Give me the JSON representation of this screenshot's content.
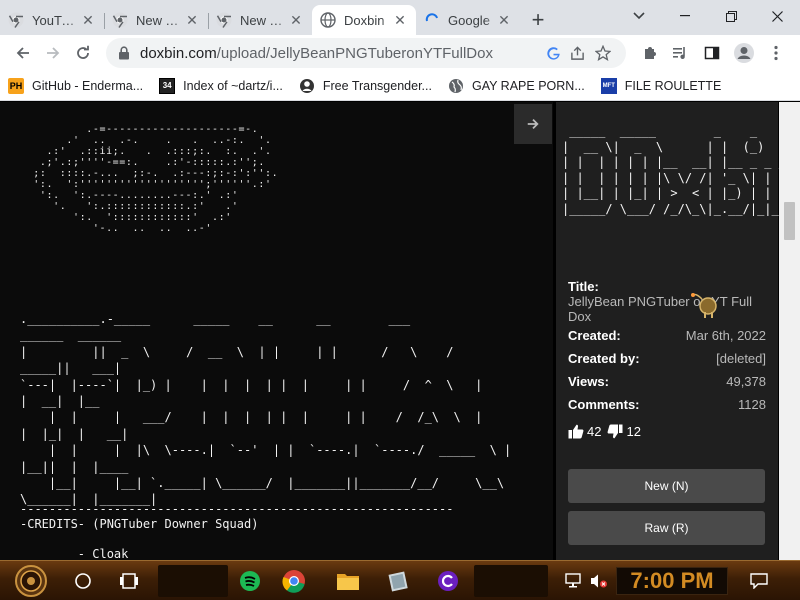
{
  "browser": {
    "tabs": [
      {
        "title": "YouTube",
        "icon": "chrome-icon",
        "active": false
      },
      {
        "title": "New Tab",
        "icon": "chrome-icon",
        "active": false
      },
      {
        "title": "New Tab",
        "icon": "chrome-icon",
        "active": false
      },
      {
        "title": "Doxbin",
        "icon": "globe-icon",
        "active": true
      },
      {
        "title": "Google",
        "icon": "loading-icon",
        "active": false
      }
    ],
    "close_glyph": "✕",
    "new_tab_glyph": "+",
    "url_host": "doxbin.com",
    "url_path": "/upload/JellyBeanPNGTuberonYTFullDox",
    "bookmarks": [
      {
        "label": "GitHub - Enderma...",
        "icon": "PH"
      },
      {
        "label": "Index of ~dartz/i...",
        "icon": "34"
      },
      {
        "label": "Free Transgender...",
        "icon": "logo"
      },
      {
        "label": "GAY RAPE PORN...",
        "icon": "globe"
      },
      {
        "label": "FILE ROULETTE",
        "icon": "MFT"
      }
    ]
  },
  "paste": {
    "art_face": "          .-=--------------------=-.\n       .'  ..  .-.    .   .  ..-:.  '.\n    .:'  .::ii;.   .  .:::;:.  :.  .'.\n   .;'.:;''''-==:.    .:'-:::::.:'';.\n  ;:  ::::.-...  ;:-.  .:---:;:-:':'':.\n  ':.  ':''''''''''''''''''';''''''.:'\n   ':.  ':.----........---:.' .:'\n     '.   ':.::::::::::::.:'   .'\n        ':.  '::::::::::::'  .:'\n           '-..  ..  ..  ..-'",
    "art_text": ".__________.-_____      _____    __      __        ___\n______  ______\n|         ||  _  \\     /  __  \\  | |     | |      /   \\    /\n_____||   ___|\n`---|  |----`|  |_) |    |  |  |  | |  |     | |     /  ^  \\   |\n|  __|  |__\n    |  |     |   ___/    |  |  |  | |  |     | |    /  /_\\  \\  |\n|  |_|  |   __|\n    |  |     |  |\\  \\----.|  `--'  | |  `----.|  `----./  _____  \\ |\n|__||  |  |____\n    |__|     |__| `._____| \\______/  |_______||_______/__/     \\__\\\n\\______|  |_______|",
    "divider": "------------------------------------------------------------",
    "credits_line": "-CREDITS- (PNGTuber Downer Squad)",
    "credit_name": "        - Cloak"
  },
  "sidebar": {
    "logo": " _____  _____        _    _\n|  __ \\|  _  \\      | |  (_)\n| |  | | | | |__  __| |__ _ _ __\n| |  | | | | |\\ \\/ /| '_ \\| | '_ \\\n| |__| | |_| | >  < | |_) | | | | |\n|_____/ \\___/ /_/\\_\\|_.__/|_|_| |_|",
    "title_label": "Title:",
    "title_value": "JellyBean PNGTuber on YT Full Dox",
    "created_label": "Created:",
    "created_value": "Mar 6th, 2022",
    "created_by_label": "Created by:",
    "created_by_value": "[deleted]",
    "views_label": "Views:",
    "views_value": "49,378",
    "comments_label": "Comments:",
    "comments_value": "1128",
    "likes": "42",
    "dislikes": "12",
    "new_button": "New (N)",
    "raw_button": "Raw (R)"
  },
  "taskbar": {
    "clock": "7:00 PM"
  },
  "colors": {
    "tabstrip": "#dee1e6",
    "page_bg": "#0b0b0b",
    "sidebar_bg": "#1f1f1f",
    "button_bg": "#4a4a4a",
    "clock_text": "#d38b23"
  }
}
